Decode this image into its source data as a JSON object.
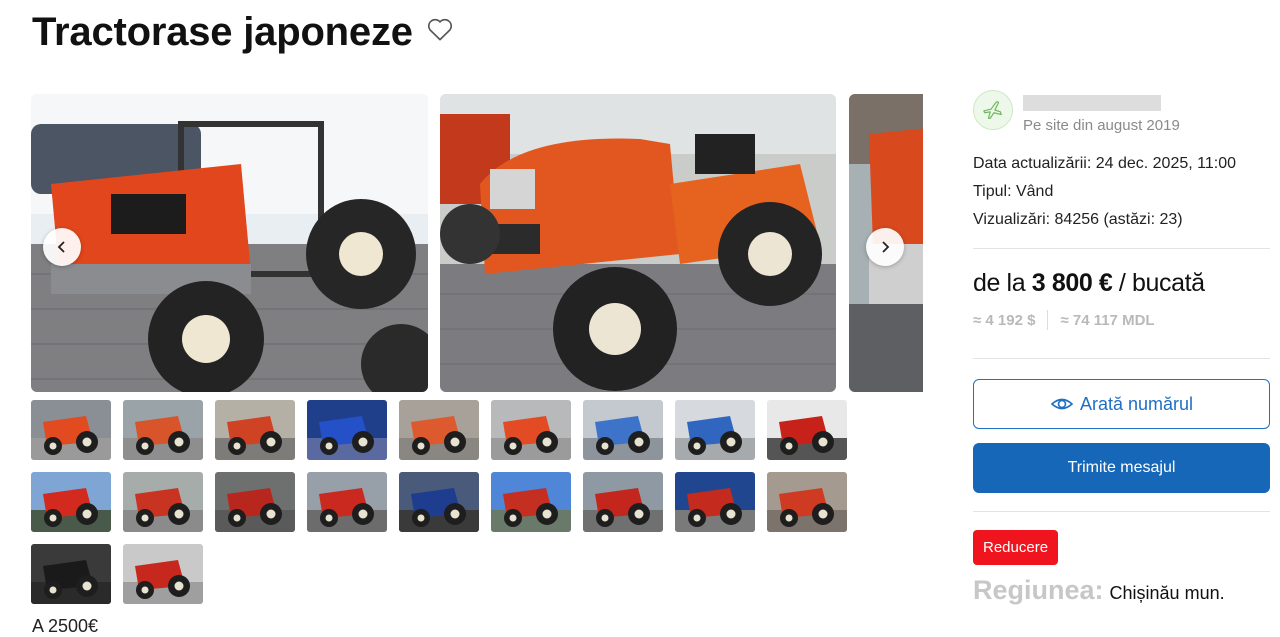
{
  "listing": {
    "title": "Tractorase japoneze"
  },
  "gallery": {
    "prev_label": "‹",
    "next_label": "›"
  },
  "thumbnails": [
    {
      "bg": "#8a8f95",
      "body": "#e24a1f",
      "ground": "#9a9a9a"
    },
    {
      "bg": "#9aa3a8",
      "body": "#d8542a",
      "ground": "#8e8e8e"
    },
    {
      "bg": "#b5b0a6",
      "body": "#cf4324",
      "ground": "#7e7c78"
    },
    {
      "bg": "#1f3f8a",
      "body": "#2450c8",
      "ground": "#5a6aa0"
    },
    {
      "bg": "#a8a19a",
      "body": "#dd5a2e",
      "ground": "#8a8682"
    },
    {
      "bg": "#b8b9ba",
      "body": "#e34b25",
      "ground": "#9b9b9b"
    },
    {
      "bg": "#c3c9cf",
      "body": "#3d74c9",
      "ground": "#8e949b"
    },
    {
      "bg": "#d6d9dd",
      "body": "#3066c0",
      "ground": "#a7aaad"
    },
    {
      "bg": "#e8e8e8",
      "body": "#c6221a",
      "ground": "#555555"
    },
    {
      "bg": "#7fa5d4",
      "body": "#d22a1e",
      "ground": "#4a5a4a"
    },
    {
      "bg": "#a6aca9",
      "body": "#c93322",
      "ground": "#8b8b8b"
    },
    {
      "bg": "#6e7070",
      "body": "#b8271d",
      "ground": "#5a5a5a"
    },
    {
      "bg": "#97a0a9",
      "body": "#c9291f",
      "ground": "#6c6c6c"
    },
    {
      "bg": "#4a5a7a",
      "body": "#1e3d8e",
      "ground": "#3a3a3a"
    },
    {
      "bg": "#4f86d8",
      "body": "#c42f22",
      "ground": "#6a7a6a"
    },
    {
      "bg": "#8f99a4",
      "body": "#c3261d",
      "ground": "#707070"
    },
    {
      "bg": "#20468f",
      "body": "#c52a1e",
      "ground": "#7a7a7a"
    },
    {
      "bg": "#a49a8f",
      "body": "#cf3a22",
      "ground": "#7c746c"
    },
    {
      "bg": "#3a3a3a",
      "body": "#1a1a1a",
      "ground": "#2a2a2a"
    },
    {
      "bg": "#c9c9c9",
      "body": "#c7281d",
      "ground": "#9f9f9f"
    }
  ],
  "seller": {
    "since": "Pe site din august 2019"
  },
  "meta": {
    "updated": "Data actualizării: 24 dec. 2025, 11:00",
    "type": "Tipul: Vând",
    "views": "Vizualizări: 84256 (astăzi: 23)"
  },
  "price": {
    "prefix": "de la ",
    "amount": "3 800 €",
    "suffix": " / bucată",
    "usd": "≈ 4 192 $",
    "mdl": "≈ 74 117 MDL"
  },
  "actions": {
    "show_number": "Arată numărul",
    "send_message": "Trimite mesajul"
  },
  "badge": {
    "label": "Reducere",
    "color": "#f0141e"
  },
  "region": {
    "label": "Regiunea:",
    "value": "Chișinău mun."
  },
  "description_fragment": "A                                                                        2500€",
  "colors": {
    "accent": "#1f6fc4",
    "primary_button": "#1667b8"
  }
}
